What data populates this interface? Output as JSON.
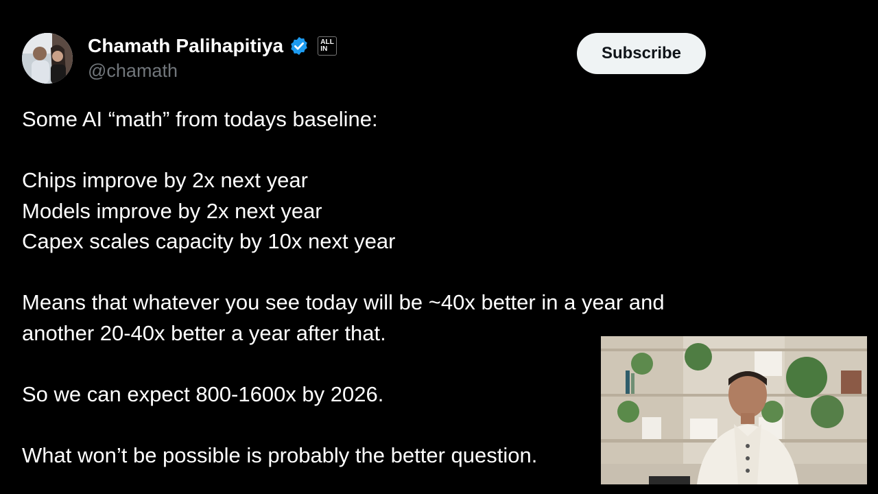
{
  "post": {
    "author": {
      "name": "Chamath Palihapitiya",
      "handle": "@chamath",
      "verified_color": "#1d9bf0",
      "affiliation_badge": {
        "line1": "ALL",
        "line2": "IN"
      }
    },
    "subscribe_label": "Subscribe",
    "body_lines": [
      "Some AI “math” from todays baseline:",
      "",
      "Chips improve by 2x next year",
      "Models improve by 2x next year",
      "Capex scales capacity by 10x next year",
      "",
      "Means that whatever you see today will be ~40x better in a year and",
      "another 20-40x better a year after that.",
      "",
      "So we can expect 800-1600x by 2026.",
      "",
      "What won’t be possible is probably the better question."
    ]
  },
  "theme": {
    "background": "#000000",
    "text": "#ffffff",
    "muted_text": "#71767b",
    "button_bg": "#eff3f4"
  }
}
